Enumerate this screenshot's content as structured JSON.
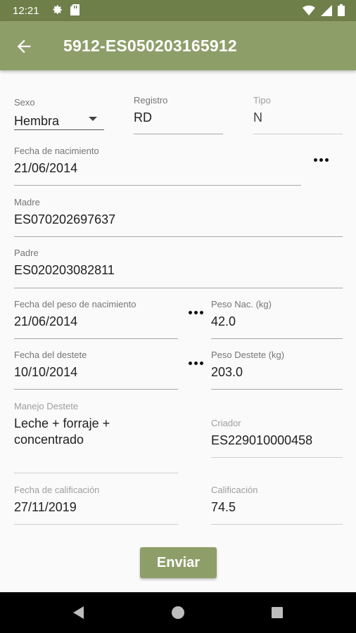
{
  "status_bar": {
    "time": "12:21",
    "left_icons": [
      "gear-icon",
      "sd-card-icon"
    ],
    "right_icons": [
      "wifi-icon",
      "signal-icon",
      "battery-icon"
    ]
  },
  "app_bar": {
    "title": "5912-ES050203165912",
    "back_icon": "arrow-back-icon"
  },
  "form": {
    "sexo": {
      "label": "Sexo",
      "value": "Hembra"
    },
    "registro": {
      "label": "Registro",
      "value": "RD"
    },
    "tipo": {
      "label": "Tipo",
      "value": "N"
    },
    "fecha_nacimiento": {
      "label": "Fecha de nacimiento",
      "value": "21/06/2014"
    },
    "madre": {
      "label": "Madre",
      "value": "ES070202697637"
    },
    "padre": {
      "label": "Padre",
      "value": "ES020203082811"
    },
    "fecha_peso_nacimiento": {
      "label": "Fecha del peso de nacimiento",
      "value": "21/06/2014"
    },
    "peso_nac": {
      "label": "Peso Nac. (kg)",
      "value": "42.0"
    },
    "fecha_destete": {
      "label": "Fecha del destete",
      "value": "10/10/2014"
    },
    "peso_destete": {
      "label": "Peso Destete (kg)",
      "value": "203.0"
    },
    "manejo_destete": {
      "label": "Manejo Destete",
      "value_line1": "Leche + forraje +",
      "value_line2": "concentrado"
    },
    "criador": {
      "label": "Criador",
      "value": "ES229010000458"
    },
    "fecha_calificacion": {
      "label": "Fecha de calificación",
      "value": "27/11/2019"
    },
    "calificacion": {
      "label": "Calificación",
      "value": "74.5"
    }
  },
  "submit_label": "Enviar",
  "nav_bar": {
    "icons": [
      "back-triangle-icon",
      "home-circle-icon",
      "recents-square-icon"
    ]
  },
  "colors": {
    "status_bar": "#6f7f4a",
    "app_bar": "#8e9e69",
    "button": "#8e9e69",
    "background": "#fafafa"
  }
}
